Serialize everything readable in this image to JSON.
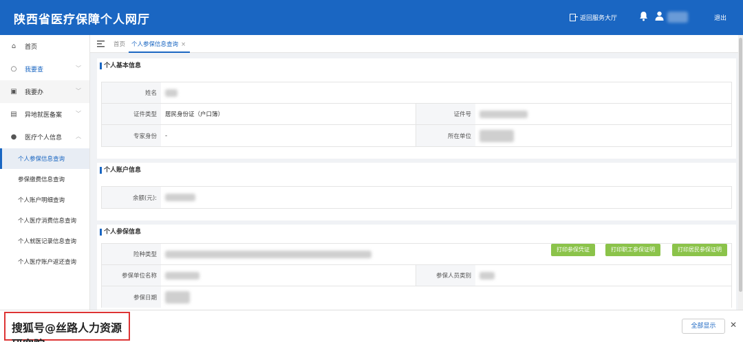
{
  "app": {
    "title": "陕西省医疗保障个人网厅"
  },
  "topbar": {
    "return_label": "返回服务大厅",
    "logout_label": "退出"
  },
  "sidebar": {
    "items": [
      {
        "label": "首页",
        "icon": "home-icon"
      },
      {
        "label": "我要查",
        "icon": "search-icon"
      },
      {
        "label": "我要办",
        "icon": "folder-icon"
      },
      {
        "label": "异地就医备案",
        "icon": "document-icon"
      },
      {
        "label": "医疗个人信息",
        "icon": "user-icon"
      }
    ],
    "sub_items": [
      "个人参保信息查询",
      "参保缴费信息查询",
      "个人账户明细查询",
      "个人医疗消费信息查询",
      "个人就医记录信息查询",
      "个人医疗账户返还查询"
    ]
  },
  "tabs": {
    "home": "首页",
    "active": "个人参保信息查询",
    "close": "×"
  },
  "basic": {
    "title": "个人基本信息",
    "name_label": "姓名",
    "id_type_label": "证件类型",
    "id_type_value": "居民身份证（户口簿）",
    "id_no_label": "证件号",
    "expert_label": "专家身份",
    "expert_value": "-",
    "unit_label": "所在单位"
  },
  "account": {
    "title": "个人账户信息",
    "balance_label": "余额(元):"
  },
  "insurance": {
    "title": "个人参保信息",
    "type_label": "险种类型",
    "unit_label": "参保单位名称",
    "category_label": "参保人员类别",
    "date_label": "参保日期",
    "btn_print_voucher": "打印参保凭证",
    "btn_print_employee": "打印职工参保证明",
    "btn_print_resident": "打印居民参保证明"
  },
  "footer": {
    "watermark": "搜狐号@丝路人力资源研究院",
    "show_all": "全部显示",
    "close": "✕"
  }
}
